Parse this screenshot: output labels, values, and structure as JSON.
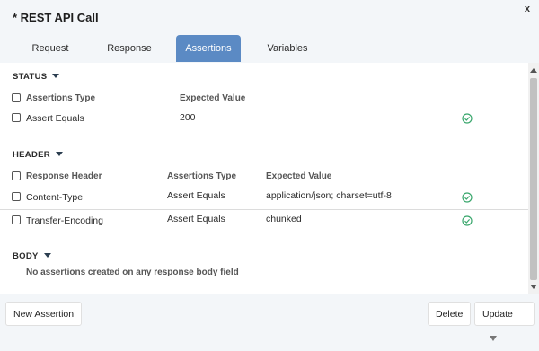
{
  "window": {
    "title": "* REST API Call",
    "close_label": "x"
  },
  "tabs": [
    {
      "label": "Request",
      "active": false
    },
    {
      "label": "Response",
      "active": false
    },
    {
      "label": "Assertions",
      "active": true
    },
    {
      "label": "Variables",
      "active": false
    }
  ],
  "status": {
    "title": "STATUS",
    "columns": [
      "Assertions Type",
      "Expected Value"
    ],
    "rows": [
      {
        "type": "Assert Equals",
        "expected": "200",
        "valid": true
      }
    ]
  },
  "header": {
    "title": "HEADER",
    "columns": [
      "Response Header",
      "Assertions Type",
      "Expected Value"
    ],
    "rows": [
      {
        "name": "Content-Type",
        "type": "Assert Equals",
        "expected": "application/json; charset=utf-8",
        "valid": true
      },
      {
        "name": "Transfer-Encoding",
        "type": "Assert Equals",
        "expected": "chunked",
        "valid": true
      }
    ]
  },
  "body": {
    "title": "BODY",
    "empty_message": "No assertions created on any response body field"
  },
  "footer": {
    "new_assertion": "New Assertion",
    "delete": "Delete",
    "update": "Update"
  },
  "colors": {
    "accent": "#5b8ac4",
    "check": "#3aa76d",
    "panel_bg": "#f3f6f9"
  }
}
